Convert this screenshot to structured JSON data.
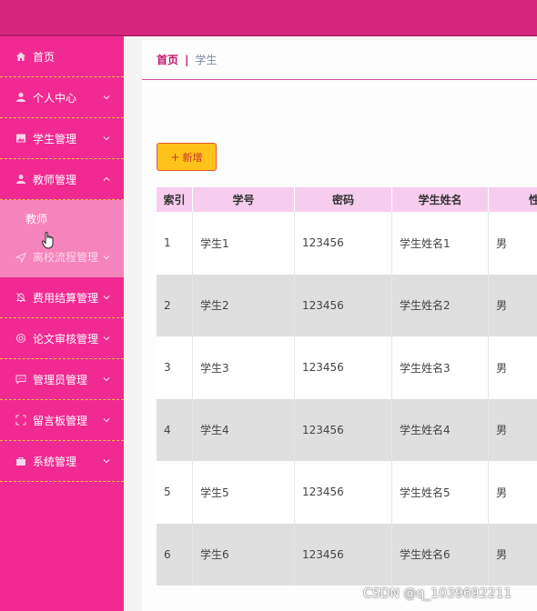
{
  "sidebar": {
    "items": [
      {
        "label": "首页",
        "icon": "home-icon"
      },
      {
        "label": "个人中心",
        "icon": "user-icon"
      },
      {
        "label": "学生管理",
        "icon": "image-icon"
      },
      {
        "label": "教师管理",
        "icon": "user-icon",
        "expanded": true,
        "sub": [
          "教师"
        ]
      },
      {
        "label": "离校流程管理",
        "icon": "send-icon"
      },
      {
        "label": "费用结算管理",
        "icon": "bell-icon"
      },
      {
        "label": "论文审核管理",
        "icon": "circle-icon"
      },
      {
        "label": "管理员管理",
        "icon": "chat-icon"
      },
      {
        "label": "留言板管理",
        "icon": "fullscreen-icon"
      },
      {
        "label": "系统管理",
        "icon": "briefcase-icon"
      }
    ]
  },
  "breadcrumb": {
    "home": "首页",
    "separator": "|",
    "current": "学生"
  },
  "toolbar": {
    "add_label": "新增",
    "add_icon": "+"
  },
  "table": {
    "headers": [
      "索引",
      "学号",
      "密码",
      "学生姓名",
      "性"
    ],
    "rows": [
      [
        "1",
        "学生1",
        "123456",
        "学生姓名1",
        "男"
      ],
      [
        "2",
        "学生2",
        "123456",
        "学生姓名2",
        "男"
      ],
      [
        "3",
        "学生3",
        "123456",
        "学生姓名3",
        "男"
      ],
      [
        "4",
        "学生4",
        "123456",
        "学生姓名4",
        "男"
      ],
      [
        "5",
        "学生5",
        "123456",
        "学生姓名5",
        "男"
      ],
      [
        "6",
        "学生6",
        "123456",
        "学生姓名6",
        "男"
      ]
    ]
  },
  "watermark": "CSDN @q_1039692211",
  "colors": {
    "topbar": "#d4287e",
    "sidebar": "#f02a92",
    "submenu": "#f584bc",
    "table_header": "#f7cdef",
    "add_button": "#ffc21a",
    "accent": "#c2186c"
  }
}
